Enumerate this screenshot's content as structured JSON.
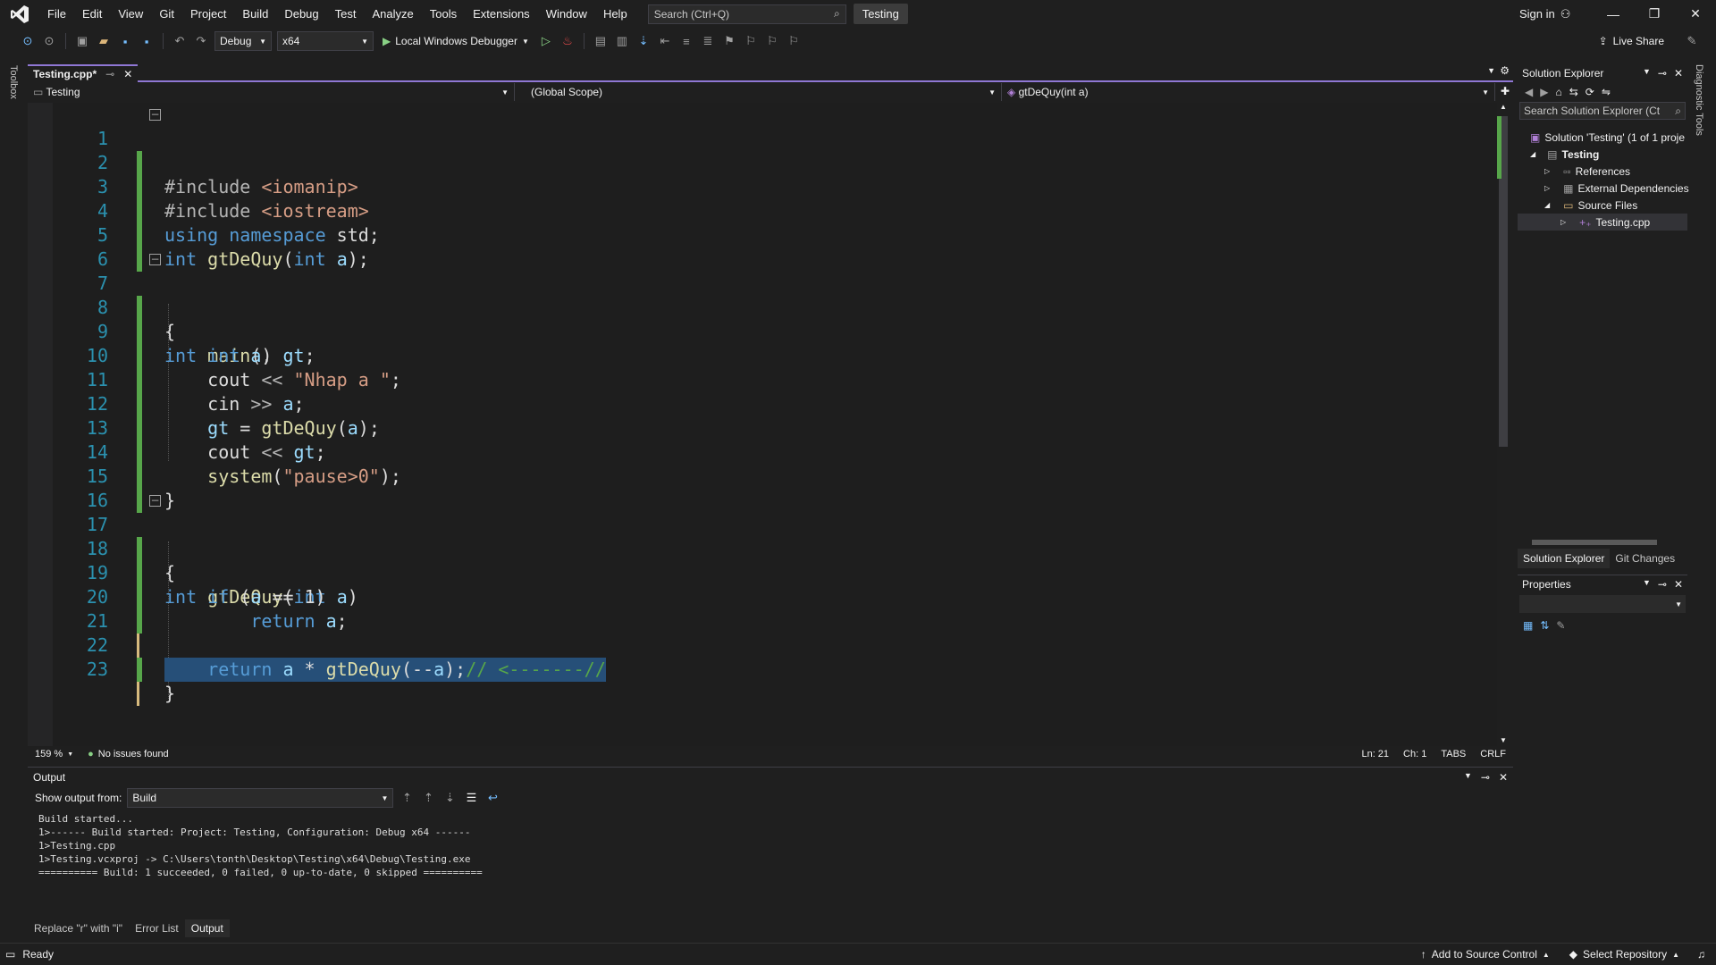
{
  "menu": {
    "items": [
      "File",
      "Edit",
      "View",
      "Git",
      "Project",
      "Build",
      "Debug",
      "Test",
      "Analyze",
      "Tools",
      "Extensions",
      "Window",
      "Help"
    ],
    "search_placeholder": "Search (Ctrl+Q)",
    "solution_name": "Testing",
    "sign_in": "Sign in"
  },
  "toolbar": {
    "configuration": "Debug",
    "platform": "x64",
    "run_label": "Local Windows Debugger",
    "live_share": "Live Share"
  },
  "side_strips": {
    "toolbox": "Toolbox",
    "diagnostic": "Diagnostic Tools"
  },
  "editor": {
    "tab_label": "Testing.cpp*",
    "nav_project": "Testing",
    "nav_scope": "(Global Scope)",
    "nav_member": "gtDeQuy(int a)",
    "zoom": "159 %",
    "issues": "No issues found",
    "line": "Ln: 21",
    "col": "Ch: 1",
    "tabs_mode": "TABS",
    "line_ending": "CRLF",
    "lines": [
      {
        "n": "1",
        "text": "#include <iostream>"
      },
      {
        "n": "2",
        "text": "#include <iomanip>"
      },
      {
        "n": "3",
        "text": "using namespace std;"
      },
      {
        "n": "4",
        "text": ""
      },
      {
        "n": "5",
        "text": "int gtDeQuy(int a);"
      },
      {
        "n": "6",
        "text": ""
      },
      {
        "n": "7",
        "text": "int main()"
      },
      {
        "n": "8",
        "text": "{"
      },
      {
        "n": "9",
        "text": "    int a, gt;"
      },
      {
        "n": "10",
        "text": "    cout << \"Nhap a \";"
      },
      {
        "n": "11",
        "text": "    cin >> a;"
      },
      {
        "n": "12",
        "text": "    gt = gtDeQuy(a);"
      },
      {
        "n": "13",
        "text": "    cout << gt;"
      },
      {
        "n": "14",
        "text": "    system(\"pause>0\");"
      },
      {
        "n": "15",
        "text": "}"
      },
      {
        "n": "16",
        "text": ""
      },
      {
        "n": "17",
        "text": "int gtDeQuy(int a)"
      },
      {
        "n": "18",
        "text": "{"
      },
      {
        "n": "19",
        "text": "    if (a == 1)"
      },
      {
        "n": "20",
        "text": "        return a;"
      },
      {
        "n": "21",
        "text": "    return a * gtDeQuy(--a);// <-------//"
      },
      {
        "n": "22",
        "text": "}"
      },
      {
        "n": "23",
        "text": ""
      }
    ]
  },
  "output": {
    "title": "Output",
    "show_from_label": "Show output from:",
    "source": "Build",
    "lines": [
      "Build started...",
      "1>------ Build started: Project: Testing, Configuration: Debug x64 ------",
      "1>Testing.cpp",
      "1>Testing.vcxproj -> C:\\Users\\tonth\\Desktop\\Testing\\x64\\Debug\\Testing.exe",
      "========== Build: 1 succeeded, 0 failed, 0 up-to-date, 0 skipped =========="
    ]
  },
  "bottom_tabs": [
    "Replace \"r\" with \"i\"",
    "Error List",
    "Output"
  ],
  "solution_explorer": {
    "title": "Solution Explorer",
    "search_placeholder": "Search Solution Explorer (Ct",
    "tree": [
      {
        "label": "Solution 'Testing' (1 of 1 proje",
        "indent": 0
      },
      {
        "label": "Testing",
        "indent": 1
      },
      {
        "label": "References",
        "indent": 2
      },
      {
        "label": "External Dependencies",
        "indent": 2
      },
      {
        "label": "Source Files",
        "indent": 2
      },
      {
        "label": "Testing.cpp",
        "indent": 3
      }
    ],
    "tabs": [
      "Solution Explorer",
      "Git Changes"
    ]
  },
  "properties": {
    "title": "Properties"
  },
  "status": {
    "ready": "Ready",
    "source_control": "Add to Source Control",
    "repository": "Select Repository"
  }
}
